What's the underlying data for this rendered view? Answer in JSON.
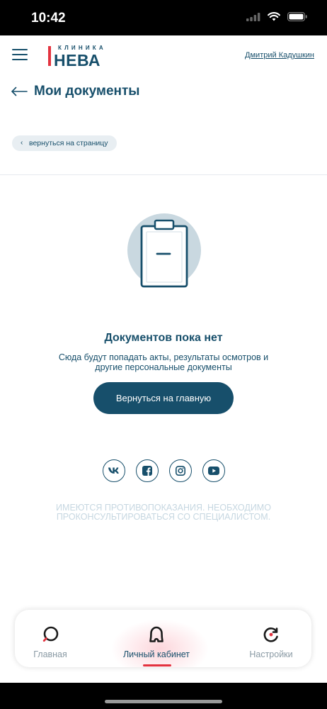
{
  "status_bar": {
    "time": "10:42"
  },
  "header": {
    "logo_small": "КЛИНИКА",
    "logo_big": "НЕВА",
    "user_name": "Дмитрий Кадушкин"
  },
  "page": {
    "title": "Мои документы",
    "return_link": "вернуться на страницу"
  },
  "empty_state": {
    "title": "Документов пока нет",
    "description": "Сюда будут попадать акты, результаты осмотров и другие персональные документы",
    "button": "Вернуться на главную"
  },
  "socials": [
    {
      "name": "vk",
      "text": "vk"
    },
    {
      "name": "facebook",
      "text": "f"
    },
    {
      "name": "instagram",
      "text": ""
    },
    {
      "name": "youtube",
      "text": ""
    }
  ],
  "disclaimer": "ИМЕЮТСЯ ПРОТИВОПОКАЗАНИЯ. НЕОБХОДИМО ПРОКОНСУЛЬТИРОВАТЬСЯ СО СПЕЦИАЛИСТОМ.",
  "tabbar": {
    "items": [
      {
        "label": "Главная",
        "icon": "search-circle-icon",
        "active": false
      },
      {
        "label": "Личный кабинет",
        "icon": "cabinet-icon",
        "active": true
      },
      {
        "label": "Настройки",
        "icon": "settings-refresh-icon",
        "active": false
      }
    ]
  },
  "colors": {
    "primary": "#174f6b",
    "accent": "#e3333f",
    "chip_bg": "#e8eef2",
    "disclaimer": "#c6d7e1"
  }
}
